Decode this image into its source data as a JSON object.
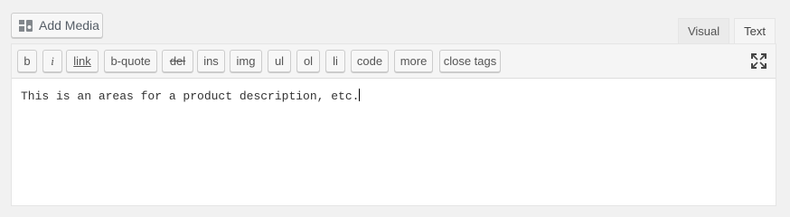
{
  "add_media": {
    "label": "Add Media",
    "icon": "media-icon"
  },
  "tabs": [
    {
      "label": "Visual",
      "active": false
    },
    {
      "label": "Text",
      "active": true
    }
  ],
  "toolbar": {
    "buttons": [
      "b",
      "i",
      "link",
      "b-quote",
      "del",
      "ins",
      "img",
      "ul",
      "ol",
      "li",
      "code",
      "more",
      "close tags"
    ],
    "fullscreen_icon": "fullscreen-icon"
  },
  "editor": {
    "text": "This is an areas for a product description, etc."
  }
}
